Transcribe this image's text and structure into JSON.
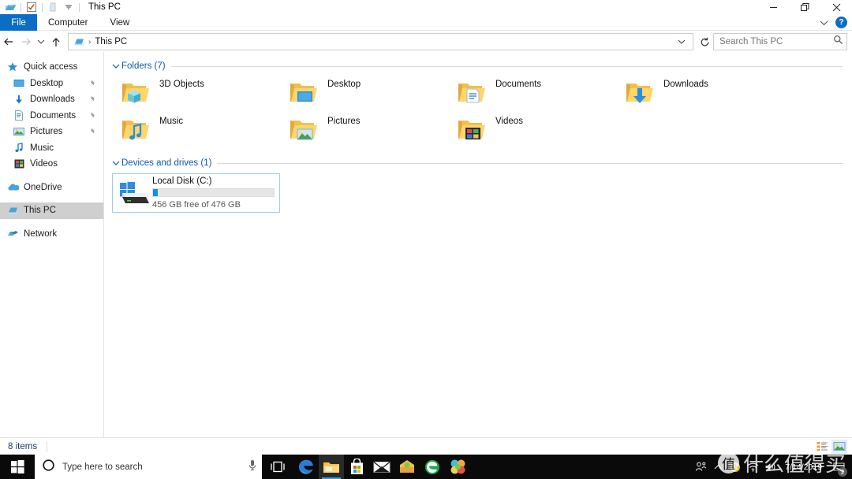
{
  "window": {
    "title": "This PC",
    "quick_access_icons": [
      "explorer-icon",
      "properties-icon",
      "new-folder-icon",
      "customize-chevron-icon"
    ],
    "controls": {
      "minimize": "minimize-button",
      "restore": "restore-button",
      "close": "close-button"
    }
  },
  "ribbon": {
    "tabs": [
      {
        "label": "File",
        "active": true
      },
      {
        "label": "Computer",
        "active": false
      },
      {
        "label": "View",
        "active": false
      }
    ],
    "expand_label": "",
    "help_label": "?"
  },
  "address_bar": {
    "back": "back-arrow",
    "forward": "forward-arrow",
    "recent": "recent-locations-chevron",
    "up": "up-arrow",
    "breadcrumb_root": "This PC",
    "separator": "›",
    "dropdown": "address-dropdown-chevron",
    "refresh": "refresh-icon"
  },
  "search": {
    "placeholder": "Search This PC",
    "icon": "search-icon"
  },
  "sidebar": {
    "items": [
      {
        "label": "Quick access",
        "icon": "star-icon",
        "pinned": false,
        "selected": false,
        "root": true
      },
      {
        "label": "Desktop",
        "icon": "desktop-icon",
        "pinned": true,
        "selected": false,
        "root": false
      },
      {
        "label": "Downloads",
        "icon": "downloads-icon",
        "pinned": true,
        "selected": false,
        "root": false
      },
      {
        "label": "Documents",
        "icon": "documents-icon",
        "pinned": true,
        "selected": false,
        "root": false
      },
      {
        "label": "Pictures",
        "icon": "pictures-icon",
        "pinned": true,
        "selected": false,
        "root": false
      },
      {
        "label": "Music",
        "icon": "music-icon",
        "pinned": false,
        "selected": false,
        "root": false
      },
      {
        "label": "Videos",
        "icon": "videos-icon",
        "pinned": false,
        "selected": false,
        "root": false
      },
      {
        "label": "OneDrive",
        "icon": "onedrive-icon",
        "pinned": false,
        "selected": false,
        "root": true
      },
      {
        "label": "This PC",
        "icon": "this-pc-icon",
        "pinned": false,
        "selected": true,
        "root": true
      },
      {
        "label": "Network",
        "icon": "network-icon",
        "pinned": false,
        "selected": false,
        "root": true
      }
    ]
  },
  "content": {
    "folders_group": {
      "title": "Folders (7)",
      "items": [
        {
          "label": "3D Objects",
          "icon": "folder-3d-objects-icon"
        },
        {
          "label": "Desktop",
          "icon": "folder-desktop-icon"
        },
        {
          "label": "Documents",
          "icon": "folder-documents-icon"
        },
        {
          "label": "Downloads",
          "icon": "folder-downloads-icon"
        },
        {
          "label": "Music",
          "icon": "folder-music-icon"
        },
        {
          "label": "Pictures",
          "icon": "folder-pictures-icon"
        },
        {
          "label": "Videos",
          "icon": "folder-videos-icon"
        }
      ]
    },
    "drives_group": {
      "title": "Devices and drives (1)",
      "items": [
        {
          "label": "Local Disk (C:)",
          "icon": "hard-drive-windows-icon",
          "free_text": "456 GB free of 476 GB",
          "used_percent": 4,
          "bar_color": "#1a8fe0",
          "selected": true
        }
      ]
    }
  },
  "status_bar": {
    "items_count": "8 items",
    "view_details": "details-view-button",
    "view_large_icons": "large-icons-view-button"
  },
  "taskbar": {
    "start": "start-button",
    "search_placeholder": "Type here to search",
    "cortana": "cortana-circle-icon",
    "microphone": "microphone-icon",
    "task_view": "task-view-button",
    "apps": [
      {
        "name": "edge-browser",
        "active": false,
        "pinned": true
      },
      {
        "name": "file-explorer",
        "active": true,
        "pinned": true
      },
      {
        "name": "microsoft-store",
        "active": false,
        "pinned": true
      },
      {
        "name": "mail",
        "active": false,
        "pinned": true
      },
      {
        "name": "yellow-app",
        "active": false,
        "pinned": true
      },
      {
        "name": "green-browser",
        "active": false,
        "pinned": true
      },
      {
        "name": "colorful-app",
        "active": false,
        "pinned": true
      }
    ],
    "tray": {
      "people": "people-icon",
      "show_hidden": "show-hidden-icons-chevron",
      "security": "security-shield-icon",
      "network": "network-wifi-icon",
      "volume": "speaker-icon",
      "date": "7/14/2019",
      "time": "",
      "notification_count": "2"
    }
  },
  "watermark": {
    "badge": "值",
    "text": "什么值得买"
  }
}
